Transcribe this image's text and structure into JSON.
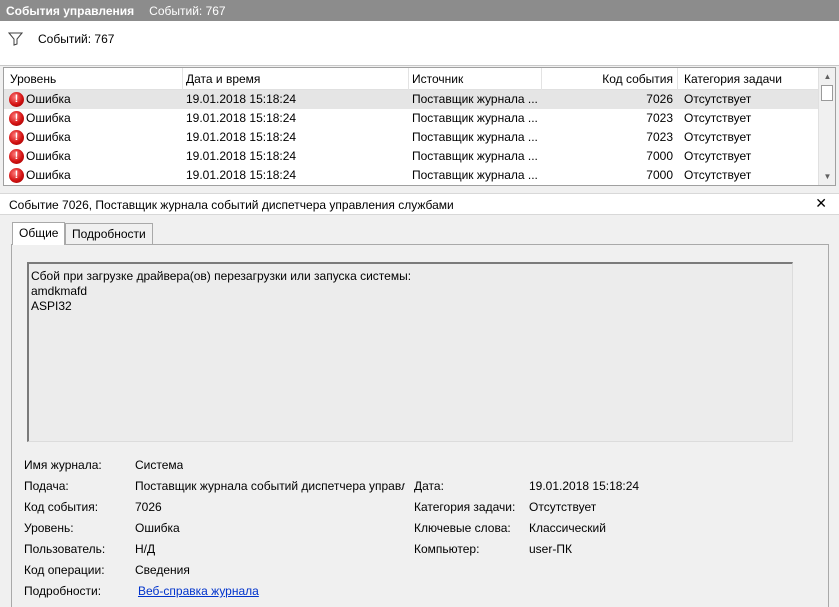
{
  "titlebar": {
    "title": "События управления",
    "count": "Событий: 767"
  },
  "filterbar": {
    "count": "Событий: 767",
    "icon": "filter-icon"
  },
  "grid": {
    "columns": [
      "Уровень",
      "Дата и время",
      "Источник",
      "Код события",
      "Категория задачи"
    ],
    "rows": [
      {
        "level": "Ошибка",
        "datetime": "19.01.2018 15:18:24",
        "source": "Поставщик журнала ...",
        "code": "7026",
        "category": "Отсутствует"
      },
      {
        "level": "Ошибка",
        "datetime": "19.01.2018 15:18:24",
        "source": "Поставщик журнала ...",
        "code": "7023",
        "category": "Отсутствует"
      },
      {
        "level": "Ошибка",
        "datetime": "19.01.2018 15:18:24",
        "source": "Поставщик журнала ...",
        "code": "7023",
        "category": "Отсутствует"
      },
      {
        "level": "Ошибка",
        "datetime": "19.01.2018 15:18:24",
        "source": "Поставщик журнала ...",
        "code": "7000",
        "category": "Отсутствует"
      },
      {
        "level": "Ошибка",
        "datetime": "19.01.2018 15:18:24",
        "source": "Поставщик журнала ...",
        "code": "7000",
        "category": "Отсутствует"
      }
    ]
  },
  "detail": {
    "title": "Событие 7026, Поставщик журнала событий диспетчера управления службами",
    "close": "✕",
    "tabs": [
      "Общие",
      "Подробности"
    ],
    "description": "Сбой при загрузке драйвера(ов) перезагрузки или запуска системы:\namdkmafd\nASPI32",
    "props": {
      "log_label": "Имя журнала:",
      "log_value": "Система",
      "source_label": "Подача:",
      "source_value": "Поставщик журнала событий диспетчера управл",
      "date_label": "Дата:",
      "date_value": "19.01.2018 15:18:24",
      "code_label": "Код события:",
      "code_value": "7026",
      "category_label": "Категория задачи:",
      "category_value": "Отсутствует",
      "level_label": "Уровень:",
      "level_value": "Ошибка",
      "keywords_label": "Ключевые слова:",
      "keywords_value": "Классический",
      "user_label": "Пользователь:",
      "user_value": "Н/Д",
      "computer_label": "Компьютер:",
      "computer_value": "user-ПК",
      "opcode_label": "Код операции:",
      "opcode_value": "Сведения",
      "details_label": "Подробности:",
      "details_link": "Веб-справка журнала"
    }
  },
  "colors": {
    "titlebar": "#8c8c8c",
    "error": "#d31212",
    "link": "#0033cc",
    "selected_row": "#e5e5e5"
  }
}
